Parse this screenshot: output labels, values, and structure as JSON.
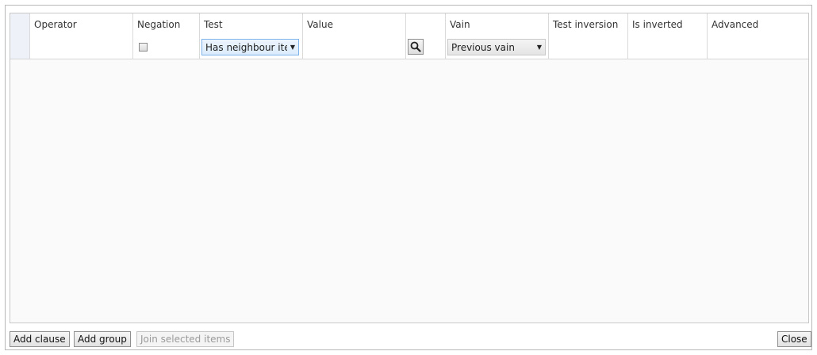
{
  "grid": {
    "columns": [
      "",
      "Operator",
      "Negation",
      "Test",
      "Value",
      "",
      "Vain",
      "Test inversion",
      "Is inverted",
      "Advanced"
    ],
    "row": {
      "negation_checked": false,
      "test": "Has neighbour iter",
      "vain": "Previous vain"
    }
  },
  "footer": {
    "add_clause": "Add clause",
    "add_group": "Add group",
    "join_selected": "Join selected items",
    "close": "Close"
  },
  "icons": {
    "search": "search-icon",
    "dropdown": "chevron-down-icon"
  }
}
